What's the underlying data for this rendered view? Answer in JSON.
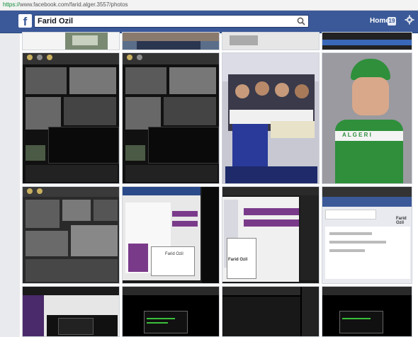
{
  "browser": {
    "url_scheme": "https://",
    "url_rest": "www.facebook.com/farid.alger.3557/photos"
  },
  "topbar": {
    "search_value": "Farid Ozil",
    "home_label": "Home",
    "home_badge": "19"
  },
  "photos": {
    "tile_r3c3_caption": "Farid Ozil",
    "tile_r3c4_caption": "Farid Ozil",
    "tile_r2c4_text": "A L G E R I"
  },
  "icons": [
    "facebook-logo-icon",
    "search-icon",
    "gear-icon"
  ],
  "colors": {
    "fb_blue": "#3b5998",
    "green": "#2f8f3b"
  }
}
